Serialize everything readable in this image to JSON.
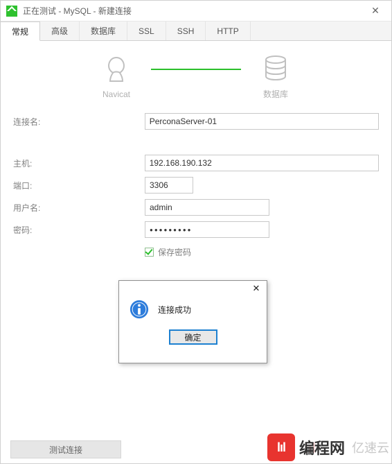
{
  "window": {
    "title": "正在测试 - MySQL - 新建连接"
  },
  "tabs": {
    "items": [
      {
        "label": "常规"
      },
      {
        "label": "高级"
      },
      {
        "label": "数据库"
      },
      {
        "label": "SSL"
      },
      {
        "label": "SSH"
      },
      {
        "label": "HTTP"
      }
    ]
  },
  "hero": {
    "left_label": "Navicat",
    "right_label": "数据库"
  },
  "form": {
    "conn_name_label": "连接名:",
    "conn_name_value": "PerconaServer-01",
    "host_label": "主机:",
    "host_value": "192.168.190.132",
    "port_label": "端口:",
    "port_value": "3306",
    "user_label": "用户名:",
    "user_value": "admin",
    "pass_label": "密码:",
    "pass_value": "●●●●●●●●●",
    "save_pass_label": "保存密码"
  },
  "dialog": {
    "message": "连接成功",
    "ok_label": "确定"
  },
  "footer": {
    "test_btn_label": "测试连接"
  },
  "watermark": {
    "badge": "lıl",
    "text_bold": "编程网",
    "text_light": "亿速云",
    "faded": "lıl"
  }
}
